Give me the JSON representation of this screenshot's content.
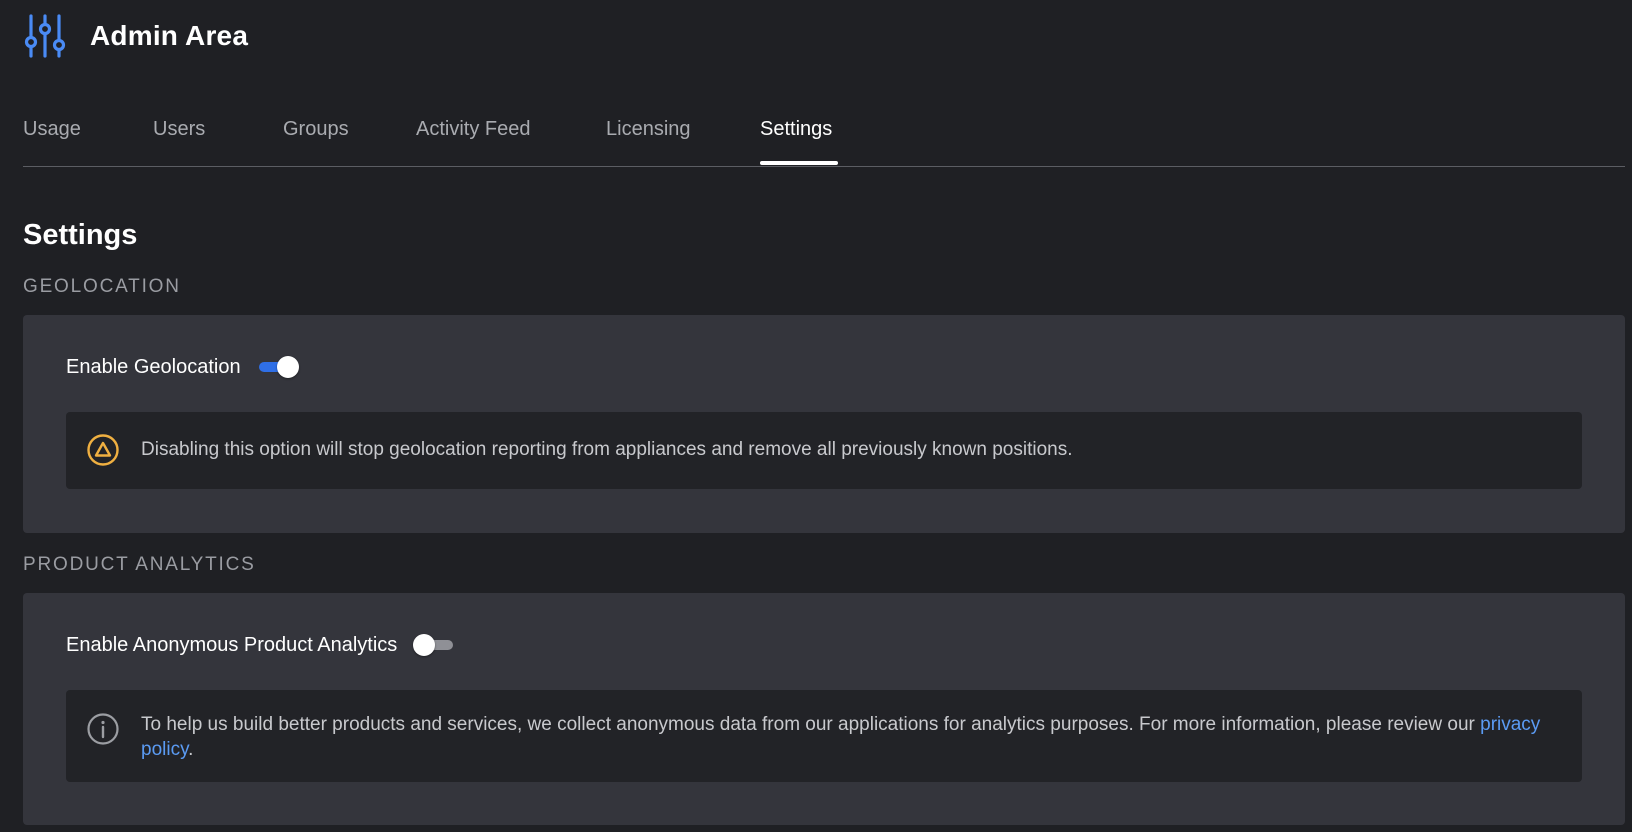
{
  "app": {
    "title": "Admin Area",
    "logo_icon": "sliders-icon"
  },
  "tabs": [
    {
      "label": "Usage",
      "active": false
    },
    {
      "label": "Users",
      "active": false
    },
    {
      "label": "Groups",
      "active": false
    },
    {
      "label": "Activity Feed",
      "active": false
    },
    {
      "label": "Licensing",
      "active": false
    },
    {
      "label": "Settings",
      "active": true
    }
  ],
  "page": {
    "title": "Settings"
  },
  "sections": {
    "geolocation": {
      "heading": "GEOLOCATION",
      "toggle_label": "Enable Geolocation",
      "toggle_on": true,
      "notice_icon": "warning-triangle-icon",
      "notice_text": "Disabling this option will stop geolocation reporting from appliances and remove all previously known positions."
    },
    "analytics": {
      "heading": "PRODUCT ANALYTICS",
      "toggle_label": "Enable Anonymous Product Analytics",
      "toggle_on": false,
      "notice_icon": "info-icon",
      "notice_text": "To help us build better products and services, we collect anonymous data from our applications for analytics purposes. For more information, please review our ",
      "notice_link": "privacy policy",
      "notice_suffix": "."
    }
  },
  "colors": {
    "background": "#1f2024",
    "card": "#34353c",
    "notice": "#222327",
    "accent": "#2f6fe6",
    "link": "#5b9bf3",
    "warning": "#f0b041"
  }
}
